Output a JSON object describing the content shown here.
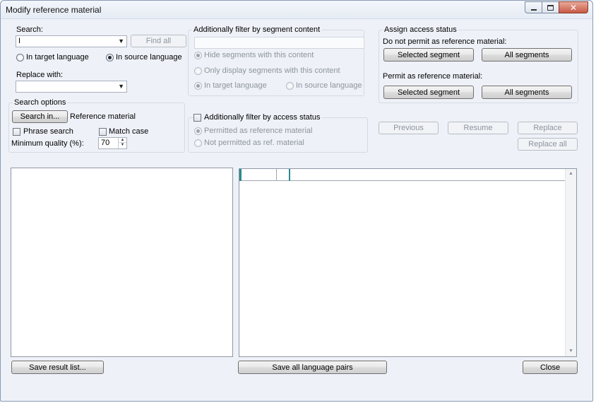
{
  "window": {
    "title": "Modify reference material",
    "minimize_icon": "minimize-icon",
    "maximize_icon": "maximize-icon",
    "close_icon": "close-icon",
    "close_glyph": "✕"
  },
  "search": {
    "label": "Search:",
    "value": "I",
    "find_all": "Find all",
    "radio_target": "In target language",
    "radio_source": "In source language",
    "selected_language": "source"
  },
  "replace": {
    "label": "Replace with:",
    "value": ""
  },
  "search_options": {
    "title": "Search options",
    "search_in_button": "Search in...",
    "search_in_value": "Reference material",
    "phrase_search": "Phrase search",
    "match_case": "Match case",
    "min_quality_label": "Minimum quality (%):",
    "min_quality_value": "70"
  },
  "segment_filter": {
    "title": "Additionally filter by segment content",
    "hide": "Hide segments with this content",
    "only_display": "Only display segments with this content",
    "in_target": "In target language",
    "in_source": "In source language"
  },
  "access_filter": {
    "title": "Additionally filter by access status",
    "permitted": "Permitted as reference material",
    "not_permitted": "Not permitted as ref. material"
  },
  "assign": {
    "title": "Assign access status",
    "do_not_permit_label": "Do not permit as reference material:",
    "permit_label": "Permit as reference material:",
    "selected_segment": "Selected segment",
    "all_segments": "All segments"
  },
  "nav": {
    "previous": "Previous",
    "resume": "Resume",
    "replace": "Replace",
    "replace_all": "Replace all"
  },
  "bottom": {
    "save_result_list": "Save result list...",
    "save_all_language_pairs": "Save all language pairs",
    "close": "Close"
  },
  "colors": {
    "accent_marker": "#2a8a8f"
  }
}
